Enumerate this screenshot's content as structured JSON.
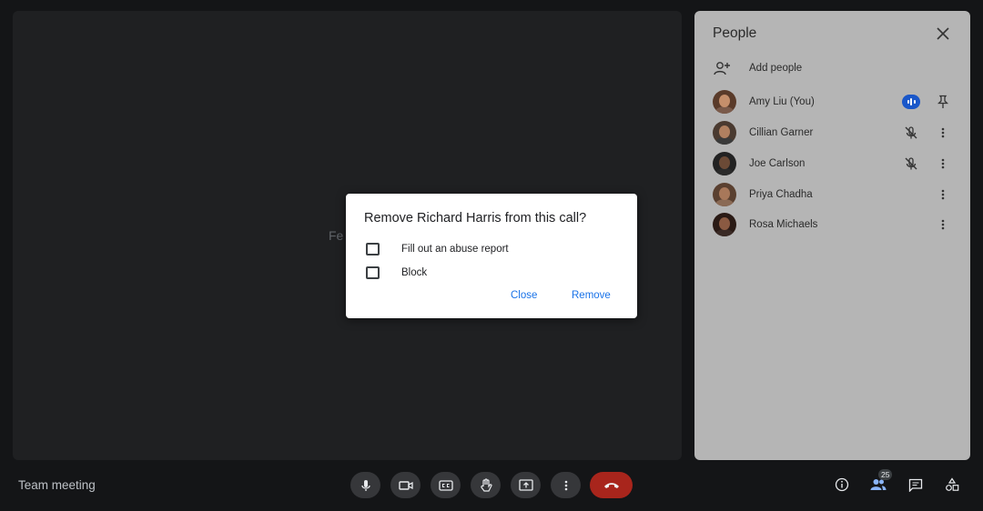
{
  "stage": {
    "hint_text": "Fe"
  },
  "people_panel": {
    "title": "People",
    "add_label": "Add people",
    "participants": [
      {
        "name": "Amy Liu (You)",
        "status": "speaking",
        "action": "pin-icon",
        "skin": "#c58f6b",
        "cloth": "#7a5a4a",
        "hair": "#5a3b2a"
      },
      {
        "name": "Cillian Garner",
        "status": "muted",
        "action": "more-vert-icon",
        "skin": "#b08060",
        "cloth": "#3a3a3a",
        "hair": "#4a3a30"
      },
      {
        "name": "Joe Carlson",
        "status": "muted",
        "action": "more-vert-icon",
        "skin": "#6b4a36",
        "cloth": "#2a2a2a",
        "hair": "#222"
      },
      {
        "name": "Priya Chadha",
        "status": "none",
        "action": "more-vert-icon",
        "skin": "#a8785a",
        "cloth": "#8a6a55",
        "hair": "#5a4030"
      },
      {
        "name": "Rosa Michaels",
        "status": "none",
        "action": "more-vert-icon",
        "skin": "#8a5a42",
        "cloth": "#3a2a25",
        "hair": "#2a1a15"
      }
    ]
  },
  "dialog": {
    "title": "Remove Richard Harris from this call?",
    "options": [
      "Fill out an abuse report",
      "Block"
    ],
    "close_label": "Close",
    "remove_label": "Remove"
  },
  "bottom_bar": {
    "meeting_name": "Team meeting",
    "people_count": "25"
  },
  "colors": {
    "accent": "#1a73e8",
    "end_call": "#a8251c",
    "speaking": "#1a57c9"
  }
}
